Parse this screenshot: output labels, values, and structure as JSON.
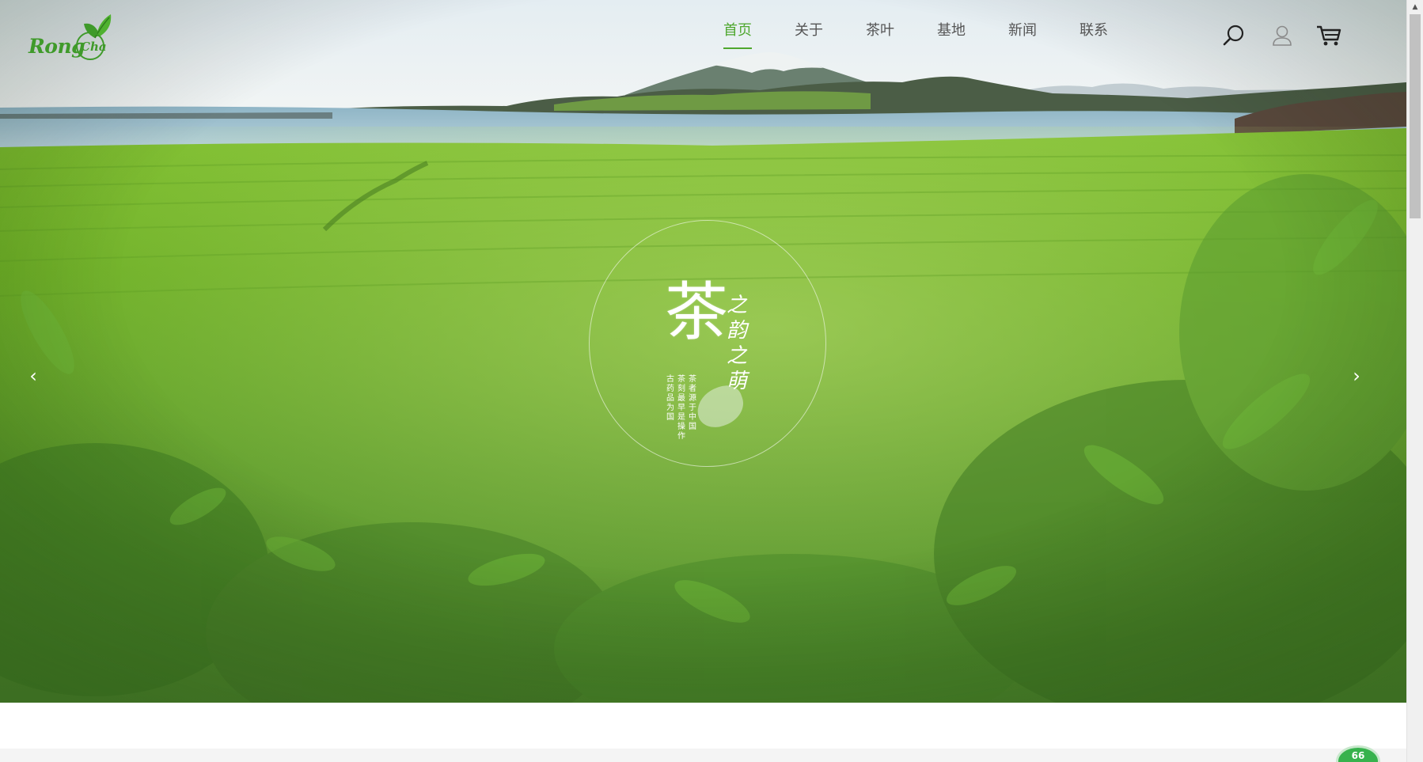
{
  "brand": {
    "logo_word_1": "Rong",
    "logo_word_2": "Cha",
    "color": "#3f9a2a"
  },
  "nav": {
    "items": [
      {
        "label": "首页",
        "active": true
      },
      {
        "label": "关于",
        "active": false
      },
      {
        "label": "茶叶",
        "active": false
      },
      {
        "label": "基地",
        "active": false
      },
      {
        "label": "新闻",
        "active": false
      },
      {
        "label": "联系",
        "active": false
      }
    ],
    "active_color": "#4ea72e",
    "text_color": "#555555"
  },
  "header_icons": [
    "search-icon",
    "user-icon",
    "cart-icon"
  ],
  "hero": {
    "emblem": {
      "main_char": "茶",
      "side_text": "之韵之萌",
      "small_text_col_1": "茶者源于中国",
      "small_text_col_2": "茶刻最早是操作",
      "small_text_col_3": "古药品为国"
    },
    "prev_arrow": "‹",
    "next_arrow": "›"
  },
  "badge": {
    "value": "66",
    "color": "#37b24d"
  }
}
